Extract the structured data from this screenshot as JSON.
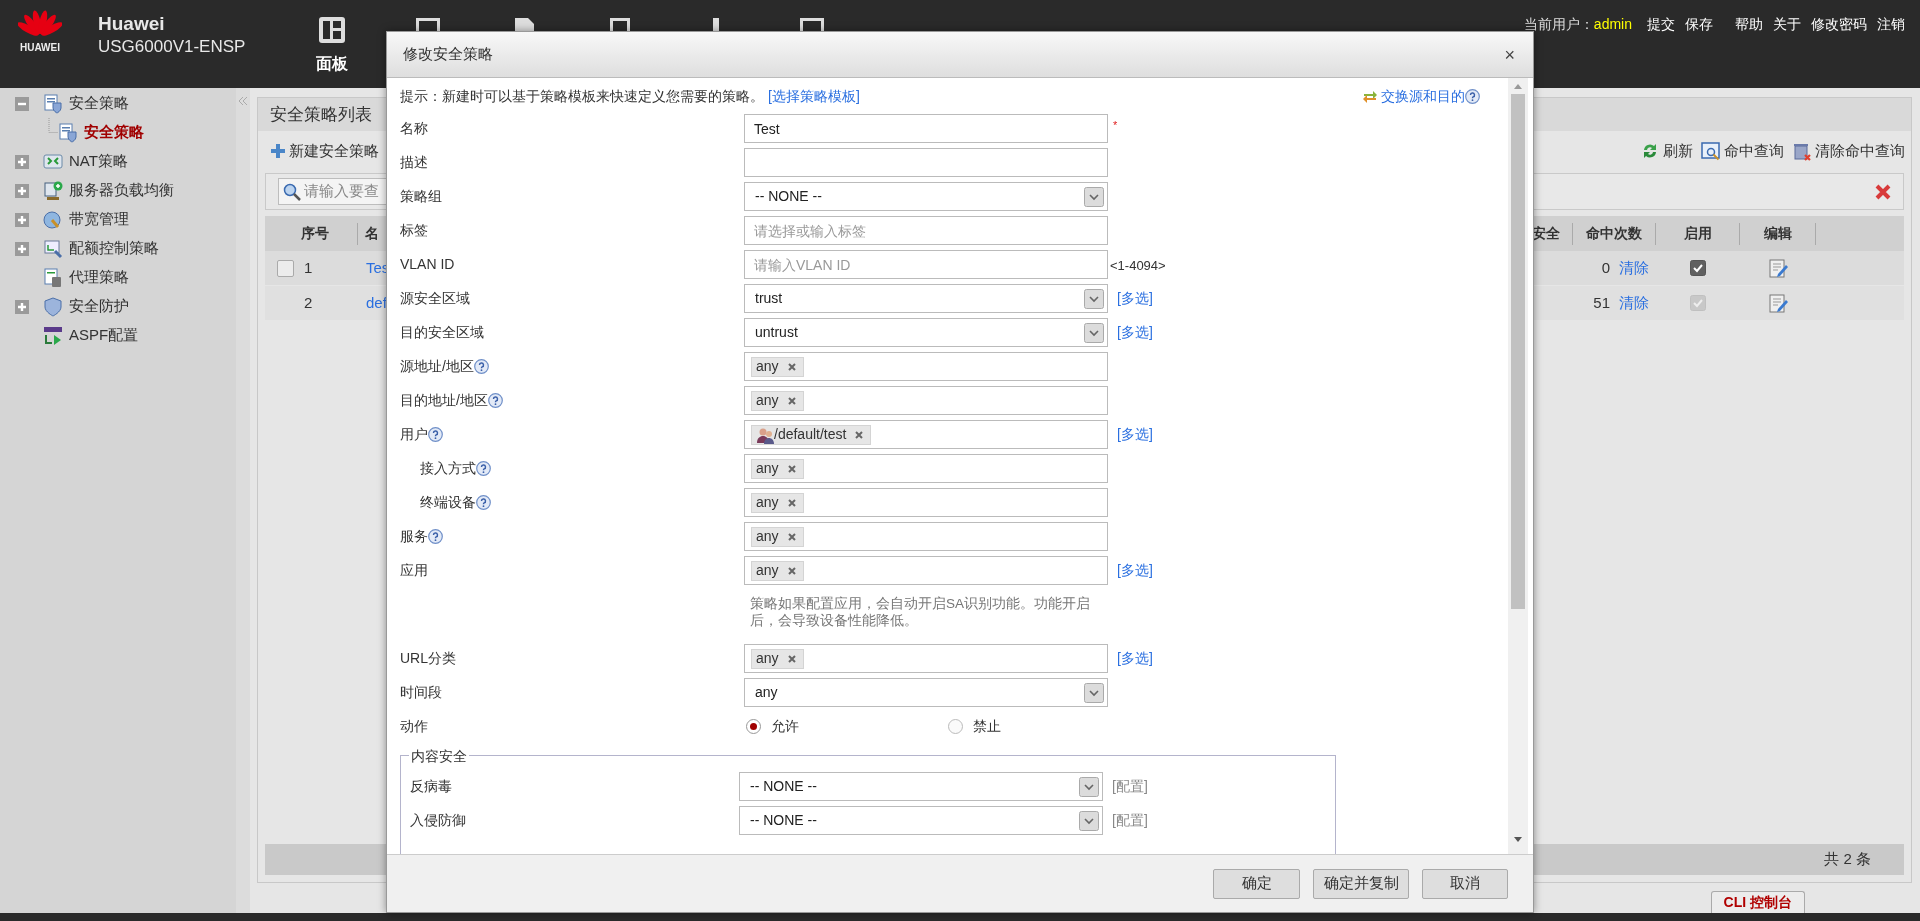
{
  "header": {
    "logo_text": "HUAWEI",
    "brand": "Huawei",
    "model": "USG6000V1-ENSP",
    "nav": [
      {
        "label": "面板"
      }
    ],
    "user_label": "当前用户：",
    "user": "admin",
    "actions": [
      "提交",
      "保存",
      "帮助",
      "关于",
      "修改密码",
      "注销"
    ]
  },
  "sidebar": {
    "items": [
      {
        "label": "安全策略",
        "selected": false,
        "expanded": true,
        "children": [
          {
            "label": "安全策略",
            "selected": true
          }
        ]
      },
      {
        "label": "NAT策略",
        "selected": false,
        "expanded": false
      },
      {
        "label": "服务器负载均衡",
        "selected": false,
        "expanded": false
      },
      {
        "label": "带宽管理",
        "selected": false,
        "expanded": false
      },
      {
        "label": "配额控制策略",
        "selected": false,
        "expanded": false
      },
      {
        "label": "代理策略",
        "selected": false
      },
      {
        "label": "安全防护",
        "selected": false,
        "expanded": false
      },
      {
        "label": "ASPF配置",
        "selected": false
      }
    ]
  },
  "panel": {
    "title": "安全策略列表",
    "toolbar": {
      "new_button": "新建安全策略",
      "actions": [
        "刷新",
        "命中查询",
        "清除命中查询"
      ]
    },
    "search": {
      "placeholder": "请输入要查"
    },
    "table": {
      "columns_left": [
        "序号",
        "名"
      ],
      "columns_right": [
        "安全",
        "命中次数",
        "启用",
        "编辑"
      ],
      "rows": [
        {
          "kind": "custom",
          "checked": false,
          "index": "1",
          "name": "Tes",
          "hits": "0",
          "clear": "清除",
          "enabled": true,
          "locked": false
        },
        {
          "kind": "default",
          "index": "2",
          "name": "def",
          "hits": "51",
          "clear": "清除",
          "enabled": true,
          "locked": true
        }
      ]
    },
    "footer": "共 2 条"
  },
  "console_tab": "CLI 控制台",
  "dialog": {
    "title": "修改安全策略",
    "close": "×",
    "hint": "提示：新建时可以基于策略模板来快速定义您需要的策略。",
    "template_link": "[选择策略模板]",
    "swap_link": "交换源和目的",
    "fields": [
      {
        "label": "名称",
        "kind": "text",
        "value": "Test",
        "required_mark": "*"
      },
      {
        "label": "描述",
        "kind": "text"
      },
      {
        "label": "策略组",
        "kind": "select",
        "value": "-- NONE --"
      },
      {
        "label": "标签",
        "kind": "text",
        "placeholder": "请选择或输入标签"
      },
      {
        "label": "VLAN ID",
        "kind": "text",
        "placeholder": "请输入VLAN ID",
        "suffix": "<1-4094>"
      },
      {
        "label": "源安全区域",
        "kind": "select",
        "value": "trust",
        "link": "[多选]"
      },
      {
        "label": "目的安全区域",
        "kind": "select",
        "value": "untrust",
        "link": "[多选]"
      },
      {
        "label": "源地址/地区",
        "kind": "tags",
        "help": true,
        "tags": [
          {
            "text": "any"
          }
        ]
      },
      {
        "label": "目的地址/地区",
        "kind": "tags",
        "help": true,
        "tags": [
          {
            "text": "any"
          }
        ]
      },
      {
        "label": "用户",
        "kind": "tags",
        "help": true,
        "tags": [
          {
            "kind": "user",
            "text": "/default/test"
          }
        ],
        "link": "[多选]",
        "children": [
          {
            "label": "接入方式",
            "kind": "tags",
            "help": true,
            "tags": [
              {
                "text": "any"
              }
            ]
          },
          {
            "label": "终端设备",
            "kind": "tags",
            "help": true,
            "tags": [
              {
                "text": "any"
              }
            ]
          }
        ]
      },
      {
        "label": "服务",
        "kind": "tags",
        "help": true,
        "tags": [
          {
            "text": "any"
          }
        ]
      },
      {
        "label": "应用",
        "kind": "tags",
        "tags": [
          {
            "text": "any"
          }
        ],
        "link": "[多选]",
        "note": "策略如果配置应用，会自动开启SA识别功能。功能开启后，会导致设备性能降低。"
      },
      {
        "label": "URL分类",
        "kind": "tags",
        "tags": [
          {
            "text": "any"
          }
        ],
        "link": "[多选]"
      },
      {
        "label": "时间段",
        "kind": "select",
        "value": "any"
      },
      {
        "label": "动作",
        "kind": "radio",
        "options": [
          {
            "label": "允许",
            "selected": true
          },
          {
            "label": "禁止",
            "selected": false
          }
        ]
      }
    ],
    "content_security": {
      "legend": "内容安全",
      "fields": [
        {
          "label": "反病毒",
          "kind": "select",
          "value": "-- NONE --",
          "link": "[配置]"
        },
        {
          "label": "入侵防御",
          "kind": "select",
          "value": "-- NONE --",
          "link": "[配置]"
        }
      ]
    },
    "buttons": [
      "确定",
      "确定并复制",
      "取消"
    ]
  }
}
